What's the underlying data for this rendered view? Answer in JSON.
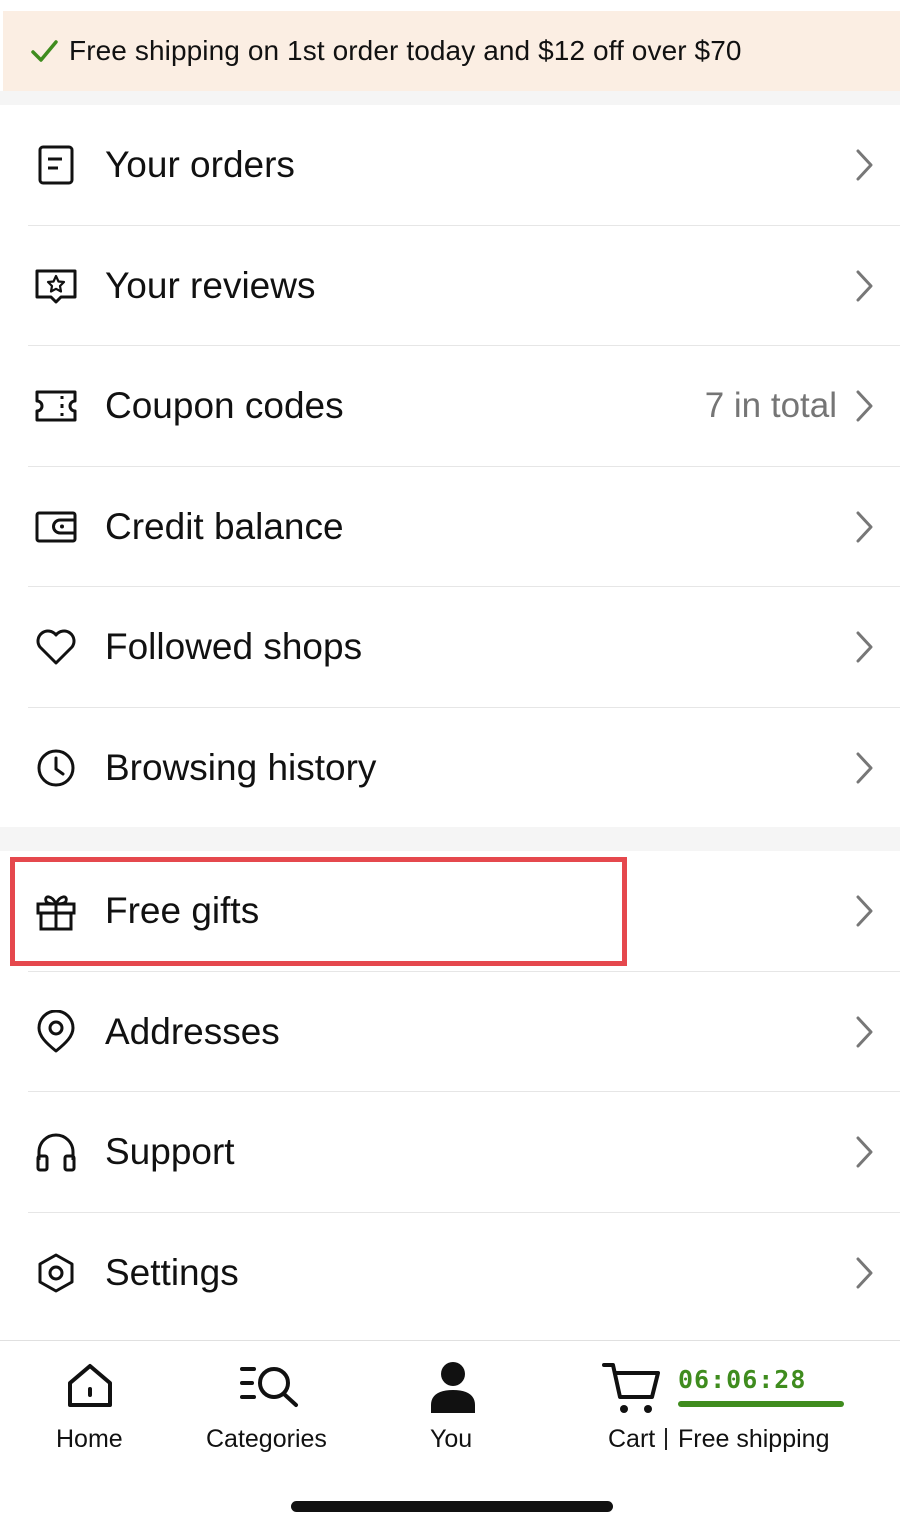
{
  "banner": {
    "icon": "checkmark-icon",
    "text": "Free shipping on 1st order today and $12 off over $70",
    "background": "#fbeee3",
    "check_color": "#3f8c1e"
  },
  "menu_group_1": [
    {
      "icon": "orders-document-icon",
      "label": "Your orders",
      "value": ""
    },
    {
      "icon": "review-star-icon",
      "label": "Your reviews",
      "value": ""
    },
    {
      "icon": "coupon-ticket-icon",
      "label": "Coupon codes",
      "value": "7 in total"
    },
    {
      "icon": "wallet-icon",
      "label": "Credit balance",
      "value": ""
    },
    {
      "icon": "heart-icon",
      "label": "Followed shops",
      "value": ""
    },
    {
      "icon": "clock-icon",
      "label": "Browsing history",
      "value": ""
    }
  ],
  "menu_group_2": [
    {
      "icon": "gift-icon",
      "label": "Free gifts",
      "value": "",
      "highlighted": true
    },
    {
      "icon": "location-pin-icon",
      "label": "Addresses",
      "value": ""
    },
    {
      "icon": "headphones-icon",
      "label": "Support",
      "value": ""
    },
    {
      "icon": "settings-hexagon-icon",
      "label": "Settings",
      "value": ""
    }
  ],
  "highlight_color": "#e5484d",
  "tabbar": {
    "home": {
      "label": "Home",
      "icon": "home-icon"
    },
    "categories": {
      "label": "Categories",
      "icon": "categories-search-icon"
    },
    "you": {
      "label": "You",
      "icon": "person-icon",
      "active": true
    },
    "cart": {
      "label": "Cart",
      "icon": "cart-icon",
      "timer": "06:06:28",
      "promo_label": "Free shipping",
      "accent": "#3f8c1e"
    }
  }
}
